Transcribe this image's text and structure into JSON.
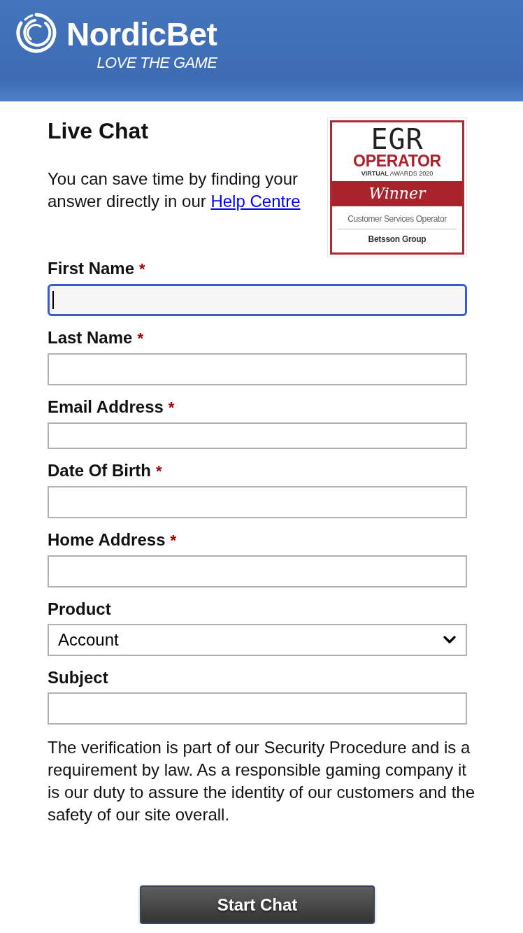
{
  "header": {
    "brand": "NordicBet",
    "tagline": "LOVE THE GAME"
  },
  "title": "Live Chat",
  "intro": {
    "text": "You can save time by finding your answer directly in our",
    "link": "Help Centre"
  },
  "badge": {
    "heading": "EGR",
    "category": "OPERATOR",
    "event": "**VIRTUAL** AWARDS 2020",
    "ribbon": "Winner",
    "award": "Customer Services Operator",
    "company": "Betsson Group"
  },
  "fields": [
    {
      "kind": "text",
      "label": "First Name",
      "required_mark": "*",
      "focused": true
    },
    {
      "kind": "text",
      "label": "Last Name",
      "required_mark": "*",
      "focused": false
    },
    {
      "kind": "email",
      "label": "Email Address",
      "required_mark": "*",
      "focused": false
    },
    {
      "kind": "text",
      "label": "Date Of Birth",
      "required_mark": "*",
      "focused": false
    },
    {
      "kind": "text",
      "label": "Home Address",
      "required_mark": "*",
      "focused": false
    },
    {
      "kind": "select",
      "label": "Product",
      "value": "Account",
      "focused": false
    },
    {
      "kind": "text",
      "label": "Subject",
      "focused": false
    }
  ],
  "notice": "The verification is part of our Security Procedure and is a requirement by law. As a responsible gaming company it is our duty to assure the identity of our customers and the safety of our site overall.",
  "button": "Start Chat"
}
